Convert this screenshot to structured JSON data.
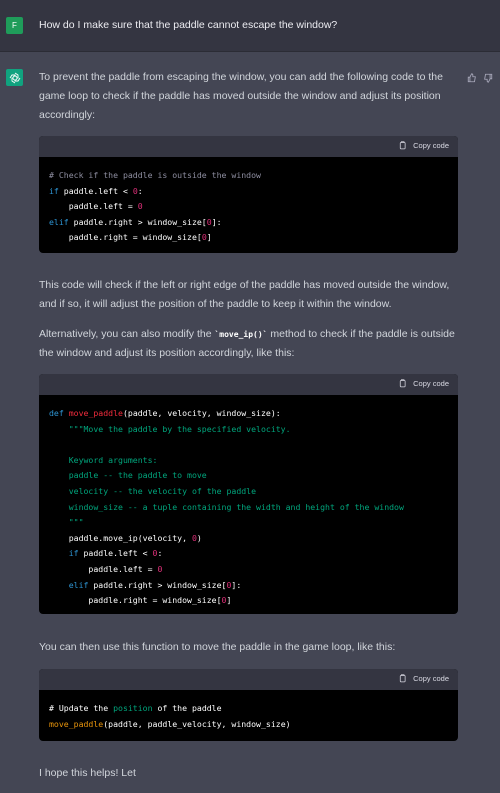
{
  "user": {
    "avatar_letter": "F",
    "message": "How do I make sure that the paddle cannot escape the window?"
  },
  "assistant": {
    "para1": "To prevent the paddle from escaping the window, you can add the following code to the game loop to check if the paddle has moved outside the window and adjust its position accordingly:",
    "para2": "This code will check if the left or right edge of the paddle has moved outside the window, and if so, it will adjust the position of the paddle to keep it within the window.",
    "para3_pre": "Alternatively, you can also modify the ",
    "para3_code": "`move_ip()`",
    "para3_post": " method to check if the paddle is outside the window and adjust its position accordingly, like this:",
    "para4": "You can then use this function to move the paddle in the game loop, like this:",
    "para5": "I hope this helps! Let"
  },
  "code_blocks": {
    "copy_label": "Copy code",
    "block1": {
      "line1": "# Check if the paddle is outside the window",
      "if": "if",
      "l2_mid": " paddle.left < ",
      "zero": "0",
      "colon": ":",
      "l3_pre": "    paddle.left = ",
      "elif": "elif",
      "l4_mid": " paddle.right > window_size[",
      "l4_end": "]:",
      "l5_pre": "    paddle.right = window_size[",
      "l5_end": "]"
    },
    "block2": {
      "def": "def",
      "fname": "move_paddle",
      "sig": "(paddle, velocity, window_size):",
      "doc1": "    \"\"\"Move the paddle by the specified velocity.",
      "doc2": "    Keyword arguments:",
      "doc3": "    paddle -- the paddle to move",
      "doc4": "    velocity -- the velocity of the paddle",
      "doc5": "    window_size -- a tuple containing the width and height of the window",
      "doc6": "    \"\"\"",
      "call_pre": "    paddle.move_ip(velocity, ",
      "call_end": ")",
      "if": "if",
      "if_mid": " paddle.left < ",
      "zero": "0",
      "colon": ":",
      "set_left": "        paddle.left = ",
      "elif": "elif",
      "elif_mid": " paddle.right > window_size[",
      "elif_end": "]:",
      "set_right": "        paddle.right = window_size[",
      "set_right_end": "]"
    },
    "block3": {
      "c1": "# Update the ",
      "c2": "position",
      "c3": " of the paddle",
      "fname": "move_paddle",
      "args": "(paddle, paddle_velocity, window_size)"
    }
  }
}
